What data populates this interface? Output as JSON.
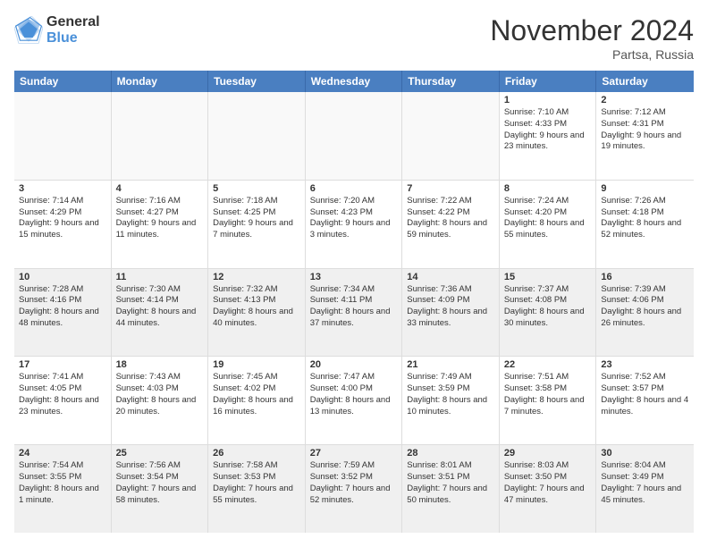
{
  "header": {
    "logo_line1": "General",
    "logo_line2": "Blue",
    "month_title": "November 2024",
    "location": "Partsa, Russia"
  },
  "weekdays": [
    "Sunday",
    "Monday",
    "Tuesday",
    "Wednesday",
    "Thursday",
    "Friday",
    "Saturday"
  ],
  "rows": [
    [
      {
        "day": "",
        "empty": true
      },
      {
        "day": "",
        "empty": true
      },
      {
        "day": "",
        "empty": true
      },
      {
        "day": "",
        "empty": true
      },
      {
        "day": "",
        "empty": true
      },
      {
        "day": "1",
        "sunrise": "Sunrise: 7:10 AM",
        "sunset": "Sunset: 4:33 PM",
        "daylight": "Daylight: 9 hours and 23 minutes."
      },
      {
        "day": "2",
        "sunrise": "Sunrise: 7:12 AM",
        "sunset": "Sunset: 4:31 PM",
        "daylight": "Daylight: 9 hours and 19 minutes."
      }
    ],
    [
      {
        "day": "3",
        "sunrise": "Sunrise: 7:14 AM",
        "sunset": "Sunset: 4:29 PM",
        "daylight": "Daylight: 9 hours and 15 minutes."
      },
      {
        "day": "4",
        "sunrise": "Sunrise: 7:16 AM",
        "sunset": "Sunset: 4:27 PM",
        "daylight": "Daylight: 9 hours and 11 minutes."
      },
      {
        "day": "5",
        "sunrise": "Sunrise: 7:18 AM",
        "sunset": "Sunset: 4:25 PM",
        "daylight": "Daylight: 9 hours and 7 minutes."
      },
      {
        "day": "6",
        "sunrise": "Sunrise: 7:20 AM",
        "sunset": "Sunset: 4:23 PM",
        "daylight": "Daylight: 9 hours and 3 minutes."
      },
      {
        "day": "7",
        "sunrise": "Sunrise: 7:22 AM",
        "sunset": "Sunset: 4:22 PM",
        "daylight": "Daylight: 8 hours and 59 minutes."
      },
      {
        "day": "8",
        "sunrise": "Sunrise: 7:24 AM",
        "sunset": "Sunset: 4:20 PM",
        "daylight": "Daylight: 8 hours and 55 minutes."
      },
      {
        "day": "9",
        "sunrise": "Sunrise: 7:26 AM",
        "sunset": "Sunset: 4:18 PM",
        "daylight": "Daylight: 8 hours and 52 minutes."
      }
    ],
    [
      {
        "day": "10",
        "sunrise": "Sunrise: 7:28 AM",
        "sunset": "Sunset: 4:16 PM",
        "daylight": "Daylight: 8 hours and 48 minutes."
      },
      {
        "day": "11",
        "sunrise": "Sunrise: 7:30 AM",
        "sunset": "Sunset: 4:14 PM",
        "daylight": "Daylight: 8 hours and 44 minutes."
      },
      {
        "day": "12",
        "sunrise": "Sunrise: 7:32 AM",
        "sunset": "Sunset: 4:13 PM",
        "daylight": "Daylight: 8 hours and 40 minutes."
      },
      {
        "day": "13",
        "sunrise": "Sunrise: 7:34 AM",
        "sunset": "Sunset: 4:11 PM",
        "daylight": "Daylight: 8 hours and 37 minutes."
      },
      {
        "day": "14",
        "sunrise": "Sunrise: 7:36 AM",
        "sunset": "Sunset: 4:09 PM",
        "daylight": "Daylight: 8 hours and 33 minutes."
      },
      {
        "day": "15",
        "sunrise": "Sunrise: 7:37 AM",
        "sunset": "Sunset: 4:08 PM",
        "daylight": "Daylight: 8 hours and 30 minutes."
      },
      {
        "day": "16",
        "sunrise": "Sunrise: 7:39 AM",
        "sunset": "Sunset: 4:06 PM",
        "daylight": "Daylight: 8 hours and 26 minutes."
      }
    ],
    [
      {
        "day": "17",
        "sunrise": "Sunrise: 7:41 AM",
        "sunset": "Sunset: 4:05 PM",
        "daylight": "Daylight: 8 hours and 23 minutes."
      },
      {
        "day": "18",
        "sunrise": "Sunrise: 7:43 AM",
        "sunset": "Sunset: 4:03 PM",
        "daylight": "Daylight: 8 hours and 20 minutes."
      },
      {
        "day": "19",
        "sunrise": "Sunrise: 7:45 AM",
        "sunset": "Sunset: 4:02 PM",
        "daylight": "Daylight: 8 hours and 16 minutes."
      },
      {
        "day": "20",
        "sunrise": "Sunrise: 7:47 AM",
        "sunset": "Sunset: 4:00 PM",
        "daylight": "Daylight: 8 hours and 13 minutes."
      },
      {
        "day": "21",
        "sunrise": "Sunrise: 7:49 AM",
        "sunset": "Sunset: 3:59 PM",
        "daylight": "Daylight: 8 hours and 10 minutes."
      },
      {
        "day": "22",
        "sunrise": "Sunrise: 7:51 AM",
        "sunset": "Sunset: 3:58 PM",
        "daylight": "Daylight: 8 hours and 7 minutes."
      },
      {
        "day": "23",
        "sunrise": "Sunrise: 7:52 AM",
        "sunset": "Sunset: 3:57 PM",
        "daylight": "Daylight: 8 hours and 4 minutes."
      }
    ],
    [
      {
        "day": "24",
        "sunrise": "Sunrise: 7:54 AM",
        "sunset": "Sunset: 3:55 PM",
        "daylight": "Daylight: 8 hours and 1 minute."
      },
      {
        "day": "25",
        "sunrise": "Sunrise: 7:56 AM",
        "sunset": "Sunset: 3:54 PM",
        "daylight": "Daylight: 7 hours and 58 minutes."
      },
      {
        "day": "26",
        "sunrise": "Sunrise: 7:58 AM",
        "sunset": "Sunset: 3:53 PM",
        "daylight": "Daylight: 7 hours and 55 minutes."
      },
      {
        "day": "27",
        "sunrise": "Sunrise: 7:59 AM",
        "sunset": "Sunset: 3:52 PM",
        "daylight": "Daylight: 7 hours and 52 minutes."
      },
      {
        "day": "28",
        "sunrise": "Sunrise: 8:01 AM",
        "sunset": "Sunset: 3:51 PM",
        "daylight": "Daylight: 7 hours and 50 minutes."
      },
      {
        "day": "29",
        "sunrise": "Sunrise: 8:03 AM",
        "sunset": "Sunset: 3:50 PM",
        "daylight": "Daylight: 7 hours and 47 minutes."
      },
      {
        "day": "30",
        "sunrise": "Sunrise: 8:04 AM",
        "sunset": "Sunset: 3:49 PM",
        "daylight": "Daylight: 7 hours and 45 minutes."
      }
    ]
  ]
}
